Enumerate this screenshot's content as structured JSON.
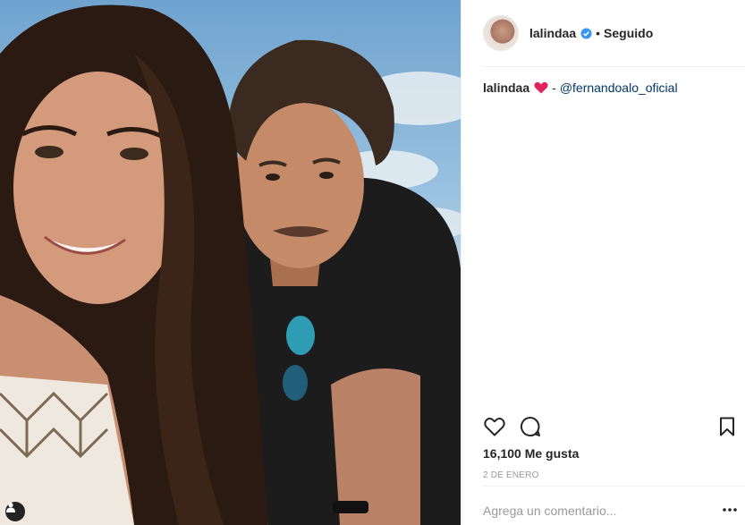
{
  "post": {
    "username": "lalindaa",
    "follow_status": "Seguido",
    "dot": "•",
    "caption": {
      "user": "lalindaa",
      "separator": "-",
      "mention": "@fernandoalo_oficial"
    },
    "likes": "16,100 Me gusta",
    "date": "2 DE ENERO",
    "comment_placeholder": "Agrega un comentario..."
  },
  "icons": {
    "verified": "verified-badge-icon",
    "heart_emoji": "red-heart-emoji",
    "like": "heart-outline-icon",
    "comment": "speech-bubble-icon",
    "save": "bookmark-icon",
    "more": "ellipsis-icon",
    "user_tag": "person-icon"
  },
  "colors": {
    "text": "#262626",
    "muted": "#999999",
    "mention": "#003569",
    "verified": "#3897f0",
    "heart": "#e0245e"
  }
}
